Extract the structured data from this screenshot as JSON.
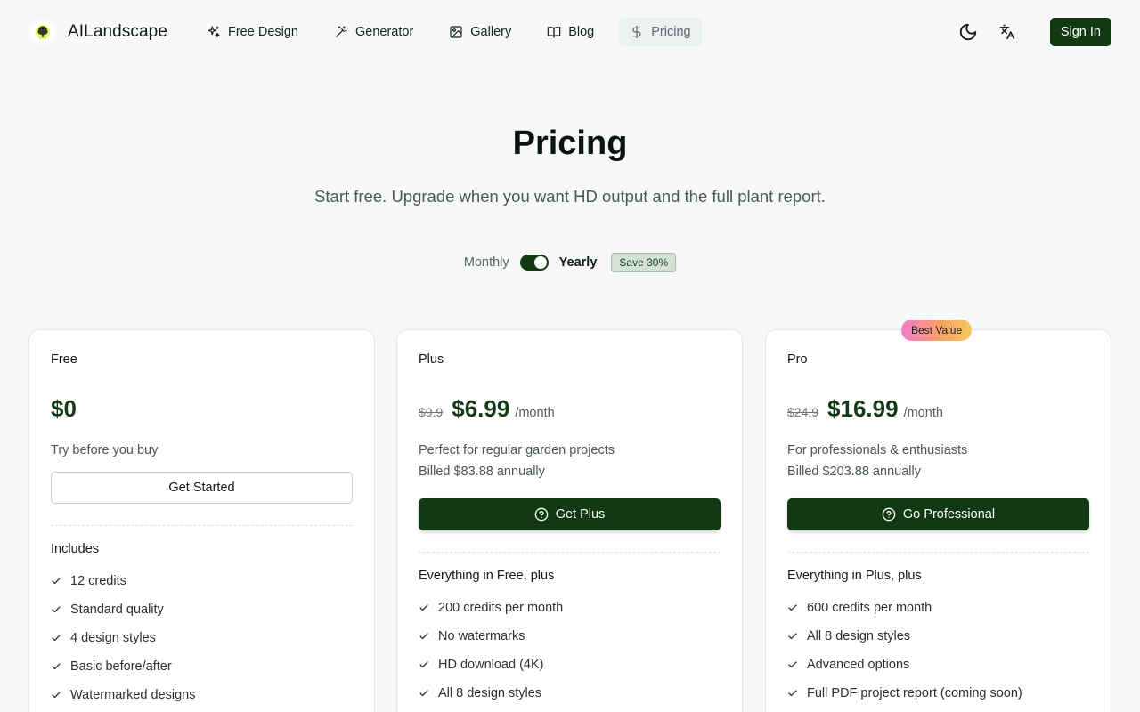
{
  "header": {
    "logo_text": "AILandscape",
    "nav": [
      {
        "label": "Free Design",
        "icon": "sparkles-icon"
      },
      {
        "label": "Generator",
        "icon": "magic-wand-icon"
      },
      {
        "label": "Gallery",
        "icon": "image-icon"
      },
      {
        "label": "Blog",
        "icon": "book-open-icon"
      },
      {
        "label": "Pricing",
        "icon": "dollar-icon"
      }
    ],
    "active_nav": "Pricing",
    "signin_label": "Sign In"
  },
  "hero": {
    "title": "Pricing",
    "subtitle": "Start free. Upgrade when you want HD output and the full plant report."
  },
  "billing": {
    "monthly_label": "Monthly",
    "yearly_label": "Yearly",
    "selected": "Yearly",
    "save_badge": "Save 30%"
  },
  "plans": {
    "free": {
      "name": "Free",
      "price": "$0",
      "description": "Try before you buy",
      "button": "Get Started",
      "features_title": "Includes",
      "features": [
        "12 credits",
        "Standard quality",
        "4 design styles",
        "Basic before/after",
        "Watermarked designs"
      ]
    },
    "plus": {
      "name": "Plus",
      "old_price": "$9.9",
      "price": "$6.99",
      "per": "/month",
      "description": "Perfect for regular garden projects",
      "billed": "Billed $83.88 annually",
      "button": "Get Plus",
      "features_title": "Everything in Free, plus",
      "features": [
        "200 credits per month",
        "No watermarks",
        "HD download (4K)",
        "All 8 design styles"
      ]
    },
    "pro": {
      "badge": "Best Value",
      "name": "Pro",
      "old_price": "$24.9",
      "price": "$16.99",
      "per": "/month",
      "description": "For professionals & enthusiasts",
      "billed": "Billed $203.88 annually",
      "button": "Go Professional",
      "features_title": "Everything in Plus, plus",
      "features": [
        "600 credits per month",
        "All 8 design styles",
        "Advanced options",
        "Full PDF project report (coming soon)"
      ]
    }
  },
  "colors": {
    "brand_green": "#123a12",
    "price_green": "#153a17",
    "background": "#f7f9f9"
  }
}
